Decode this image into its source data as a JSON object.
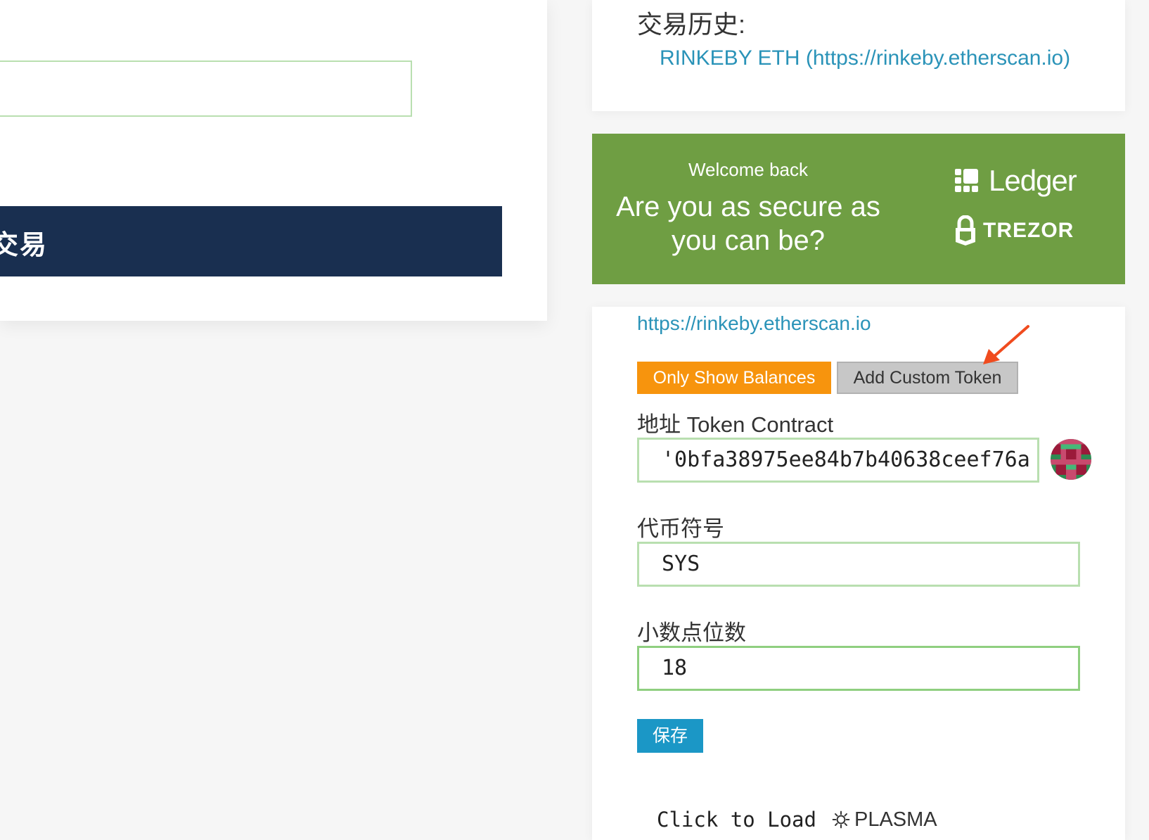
{
  "left": {
    "bar_label": "交易"
  },
  "history": {
    "title": "交易历史:",
    "link": "RINKEBY ETH (https://rinkeby.etherscan.io)"
  },
  "banner": {
    "welcome": "Welcome back",
    "headline_line1": "Are you as secure as",
    "headline_line2": "you can be?",
    "brand1": "Ledger",
    "brand2": "TREZOR",
    "bg_color": "#6f9e43"
  },
  "tokens": {
    "explorer_link": "https://rinkeby.etherscan.io",
    "only_show_balances_label": "Only Show Balances",
    "add_custom_token_label": "Add Custom Token",
    "contract_label": "地址 Token Contract",
    "contract_value": "'0bfa38975ee84b7b40638ceef76a",
    "symbol_label": "代币符号",
    "symbol_value": "SYS",
    "decimals_label": "小数点位数",
    "decimals_value": "18",
    "save_label": "保存",
    "click_to_load": "Click to Load",
    "plasma": "PLASMA",
    "accent_orange": "#f7940d",
    "accent_blue": "#1b97c6"
  }
}
